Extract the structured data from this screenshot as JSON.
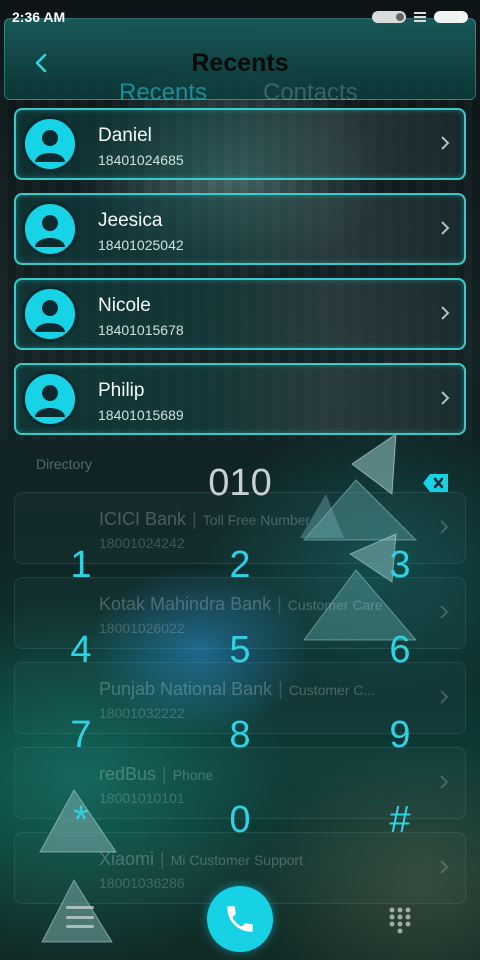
{
  "status_bar": {
    "time": "2:36 AM"
  },
  "header": {
    "title": "Recents",
    "tabs": [
      {
        "label": "Recents",
        "active": true
      },
      {
        "label": "Contacts",
        "active": false
      }
    ]
  },
  "contacts": [
    {
      "name": "Daniel",
      "number": "18401024685"
    },
    {
      "name": "Jeesica",
      "number": "18401025042"
    },
    {
      "name": "Nicole",
      "number": "18401015678"
    },
    {
      "name": "Philip",
      "number": "18401015689"
    }
  ],
  "directory": {
    "label": "Directory",
    "items": [
      {
        "name": "ICICI Bank",
        "sub": "Toll Free Number",
        "number": "18001024242"
      },
      {
        "name": "Kotak Mahindra Bank",
        "sub": "Customer Care",
        "number": "18001026022"
      },
      {
        "name": "Punjab National Bank",
        "sub": "Customer C...",
        "number": "18001032222"
      },
      {
        "name": "redBus",
        "sub": "Phone",
        "number": "18001010101"
      },
      {
        "name": "Xiaomi",
        "sub": "Mi Customer Support",
        "number": "18001036286"
      }
    ]
  },
  "dialer": {
    "input": "010",
    "keys": [
      "1",
      "2",
      "3",
      "4",
      "5",
      "6",
      "7",
      "8",
      "9",
      "*",
      "0",
      "#"
    ]
  },
  "colors": {
    "accent": "#17d3e6",
    "key_text": "#2fd2e3",
    "row_border": "#3cdcdc"
  },
  "icons": {
    "back": "chevron-left-icon",
    "avatar": "person-icon",
    "row": "chevron-right-icon",
    "backspace": "backspace-icon",
    "call": "phone-icon",
    "menu": "menu-icon",
    "dialpad": "dialpad-icon"
  }
}
